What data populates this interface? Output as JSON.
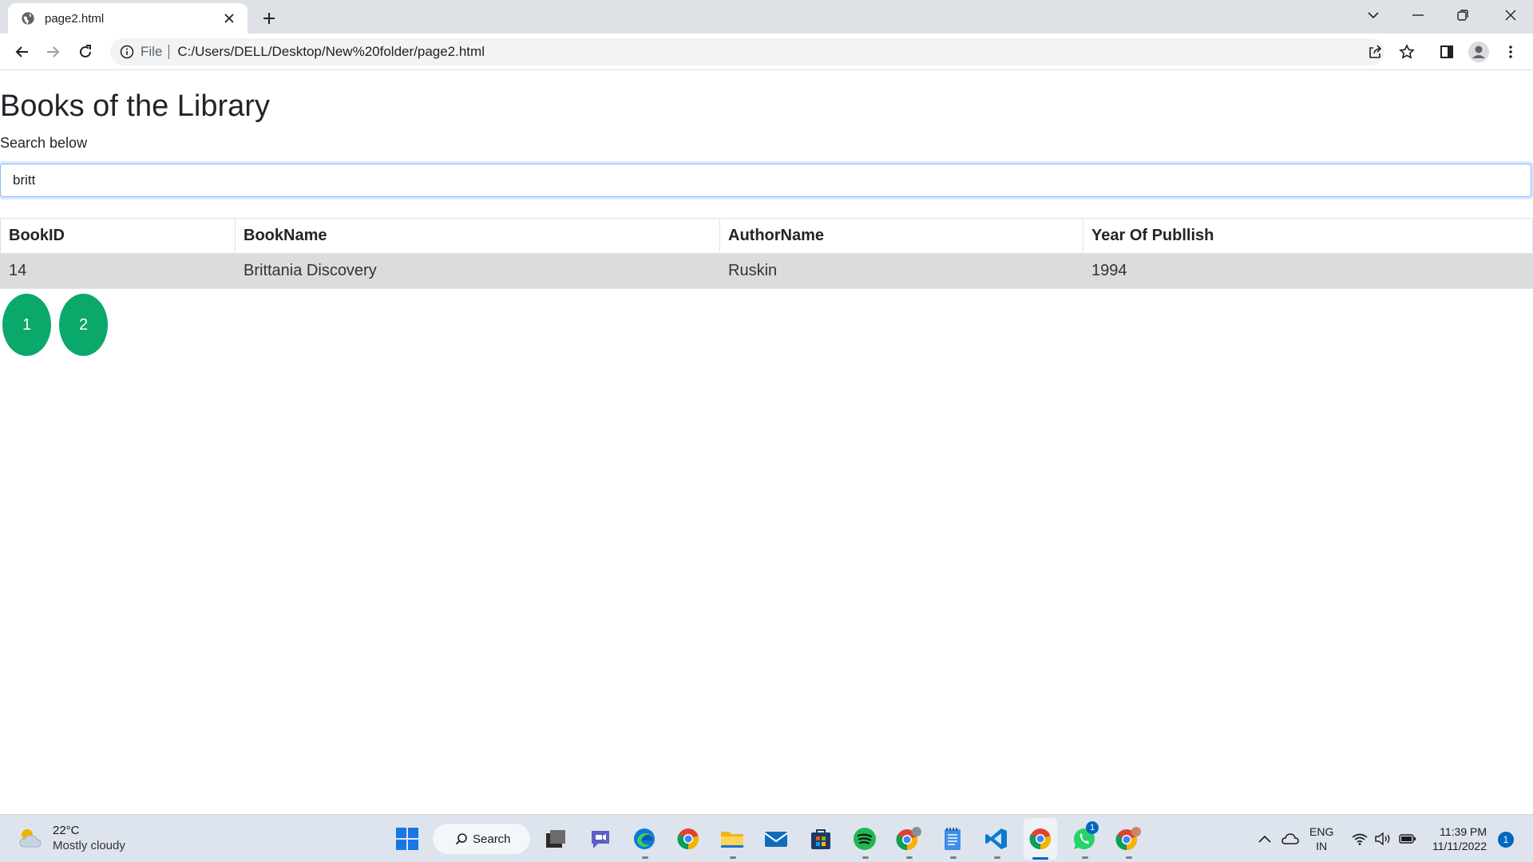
{
  "browser": {
    "tab_title": "page2.html",
    "omnibox": {
      "scheme": "File",
      "url": "C:/Users/DELL/Desktop/New%20folder/page2.html"
    }
  },
  "page": {
    "title": "Books of the Library",
    "search_label": "Search below",
    "search_value": "britt",
    "table": {
      "headers": [
        "BookID",
        "BookName",
        "AuthorName",
        "Year Of Publlish"
      ],
      "rows": [
        [
          "14",
          "Brittania Discovery",
          "Ruskin",
          "1994"
        ]
      ]
    },
    "pagination": [
      "1",
      "2"
    ],
    "accent_color": "#0aa86b"
  },
  "taskbar": {
    "weather": {
      "temp": "22°C",
      "condition": "Mostly cloudy"
    },
    "search_label": "Search",
    "apps": [
      "start-icon",
      "task-view-icon",
      "chat-icon",
      "edge-icon",
      "chrome-icon",
      "file-explorer-icon",
      "mail-icon",
      "store-icon",
      "spotify-icon",
      "chrome-profile-icon",
      "notepad-icon",
      "vscode-icon",
      "chrome-active-icon",
      "whatsapp-icon",
      "chrome-profile2-icon"
    ],
    "whatsapp_badge": "1",
    "language": {
      "line1": "ENG",
      "line2": "IN"
    },
    "clock": {
      "time": "11:39 PM",
      "date": "11/11/2022"
    },
    "notification_count": "1"
  }
}
